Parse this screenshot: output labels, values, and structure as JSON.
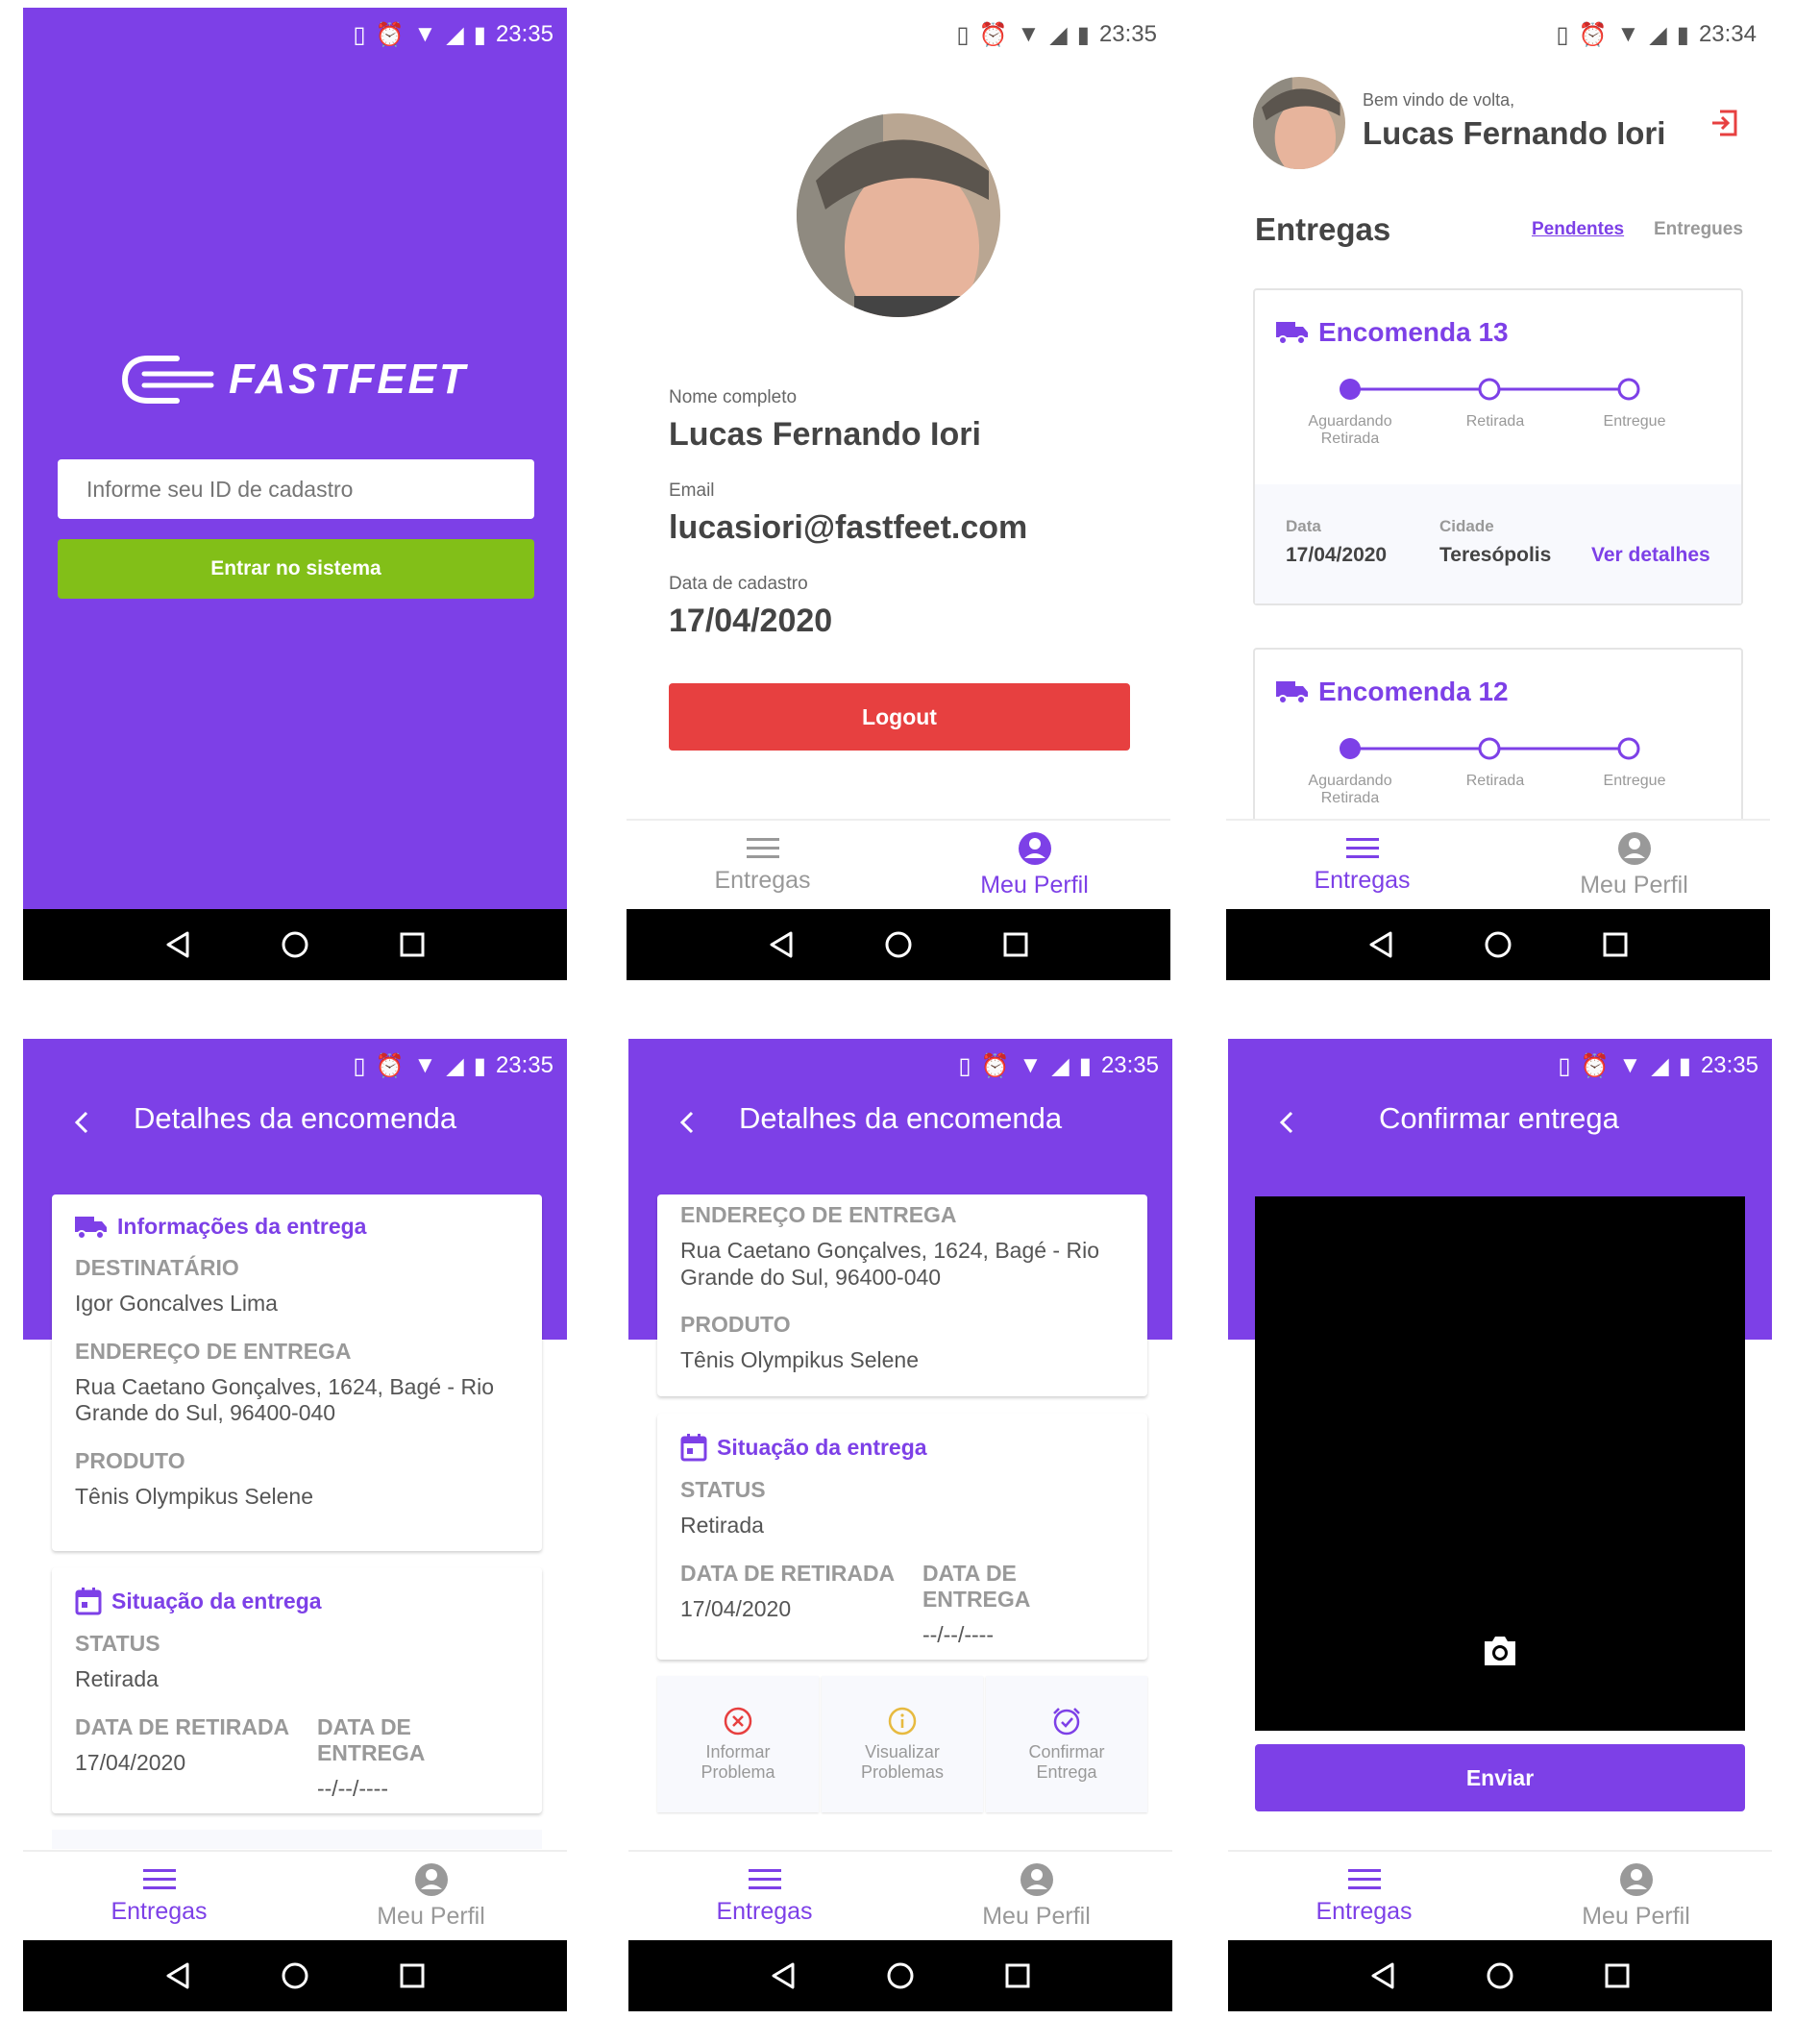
{
  "status": {
    "time_a": "23:35",
    "time_b": "23:34"
  },
  "colors": {
    "primary": "#7d40e7",
    "green": "#82bf18",
    "red": "#e74040"
  },
  "tabs": {
    "deliveries": "Entregas",
    "profile": "Meu Perfil"
  },
  "login": {
    "brand": "FASTFEET",
    "id_placeholder": "Informe seu ID de cadastro",
    "submit_label": "Entrar no sistema"
  },
  "profile": {
    "name_label": "Nome completo",
    "name": "Lucas Fernando Iori",
    "email_label": "Email",
    "email": "lucasiori@fastfeet.com",
    "date_label": "Data de cadastro",
    "date": "17/04/2020",
    "logout_label": "Logout"
  },
  "dashboard": {
    "welcome": "Bem vindo de volta,",
    "user_name": "Lucas Fernando Iori",
    "title": "Entregas",
    "filter_pending": "Pendentes",
    "filter_delivered": "Entregues",
    "steps": [
      "Aguardando Retirada",
      "Retirada",
      "Entregue"
    ],
    "orders": [
      {
        "title": "Encomenda 13",
        "date_label": "Data",
        "date": "17/04/2020",
        "city_label": "Cidade",
        "city": "Teresópolis",
        "details_label": "Ver detalhes"
      },
      {
        "title": "Encomenda 12"
      }
    ]
  },
  "details": {
    "title": "Detalhes da encomenda",
    "info_title": "Informações da entrega",
    "recipient_label": "DESTINATÁRIO",
    "recipient": "Igor Goncalves Lima",
    "address_label": "ENDEREÇO DE ENTREGA",
    "address_line1": "Rua Caetano Gonçalves, 1624, Bagé - Rio",
    "address_line2": "Grande do Sul, 96400-040",
    "product_label": "PRODUTO",
    "product": "Tênis Olympikus Selene",
    "situation_title": "Situação da entrega",
    "status_label": "STATUS",
    "status": "Retirada",
    "pickup_label": "DATA DE RETIRADA",
    "pickup": "17/04/2020",
    "delivery_label": "DATA DE ENTREGA",
    "delivery": "--/--/----",
    "actions": [
      {
        "line1": "Informar",
        "line2": "Problema"
      },
      {
        "line1": "Visualizar",
        "line2": "Problemas"
      },
      {
        "line1": "Confirmar",
        "line2": "Entrega"
      }
    ]
  },
  "confirm": {
    "title": "Confirmar entrega",
    "send_label": "Enviar"
  }
}
